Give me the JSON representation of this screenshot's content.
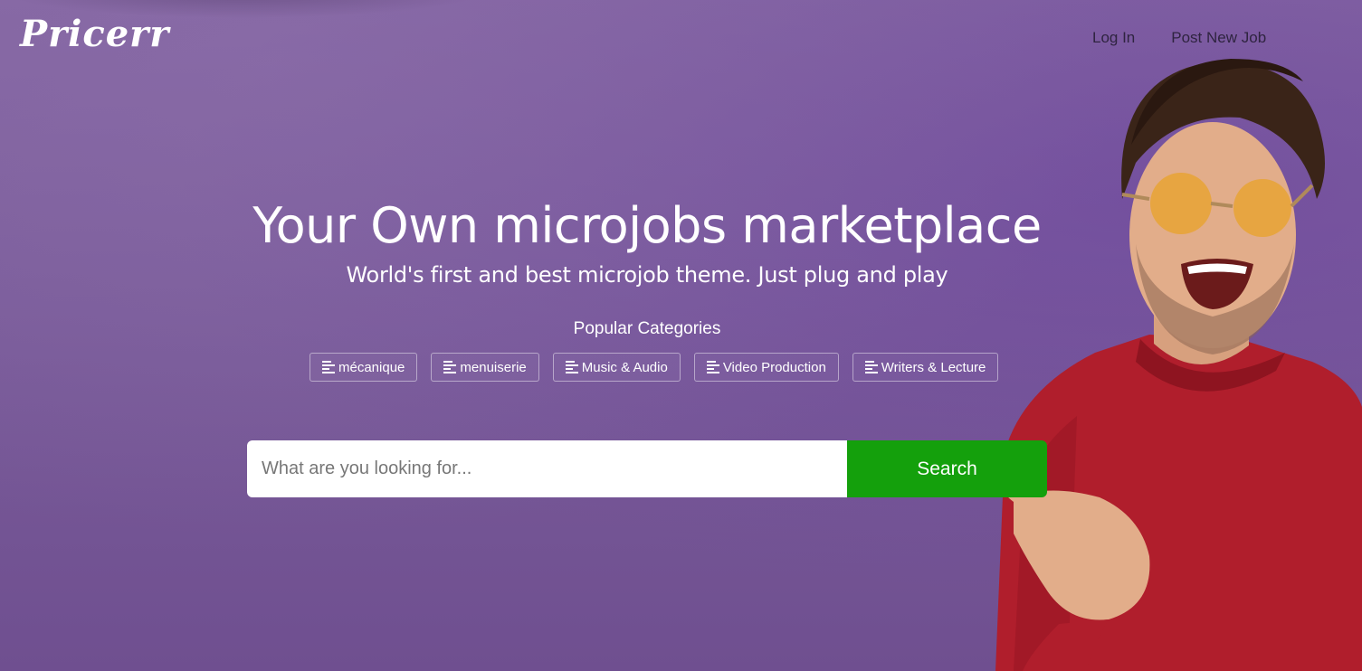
{
  "header": {
    "logo": "Pricerr",
    "nav": [
      "Log In",
      "Post New Job"
    ]
  },
  "hero": {
    "title": "Your Own microjobs marketplace",
    "subtitle": "World's first and best microjob theme. Just plug and play",
    "categories_title": "Popular Categories",
    "categories": [
      "mécanique",
      "menuiserie",
      "Music & Audio",
      "Video Production",
      "Writers & Lecture"
    ]
  },
  "search": {
    "placeholder": "What are you looking for...",
    "button_label": "Search"
  },
  "colors": {
    "background": "#7a5c9c",
    "search_button": "#14a00c",
    "sweater": "#b01e2c"
  }
}
